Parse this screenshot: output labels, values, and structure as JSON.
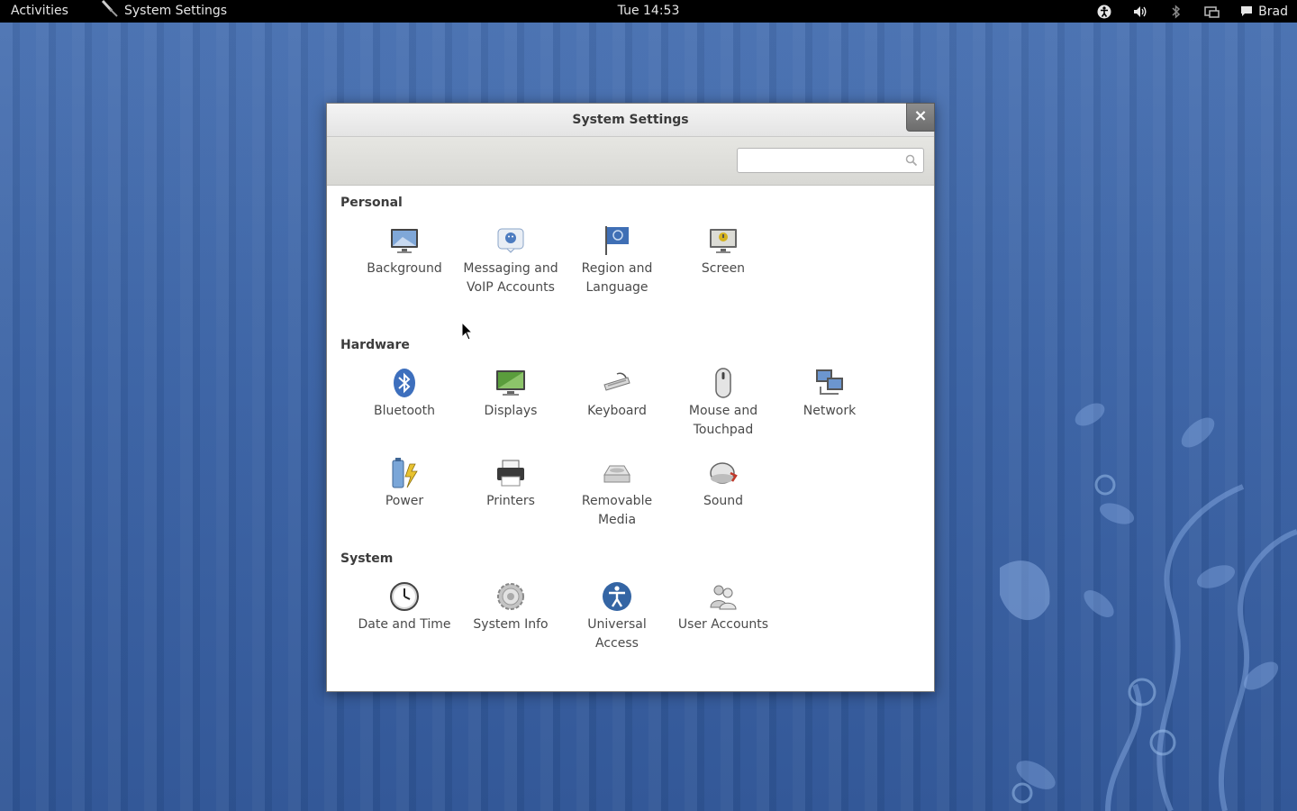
{
  "topbar": {
    "activities": "Activities",
    "app_name": "System Settings",
    "clock": "Tue 14:53",
    "user": "Brad"
  },
  "window": {
    "title": "System Settings",
    "close_glyph": "×",
    "search": {
      "value": "",
      "placeholder": ""
    }
  },
  "sections": {
    "personal": "Personal",
    "hardware": "Hardware",
    "system": "System"
  },
  "items": {
    "background": "Background",
    "messaging": "Messaging and VoIP Accounts",
    "region": "Region and Language",
    "screen": "Screen",
    "bluetooth": "Bluetooth",
    "displays": "Displays",
    "keyboard": "Keyboard",
    "mouse": "Mouse and Touchpad",
    "network": "Network",
    "power": "Power",
    "printers": "Printers",
    "removable": "Removable Media",
    "sound": "Sound",
    "datetime": "Date and Time",
    "sysinfo": "System Info",
    "universal": "Universal Access",
    "users": "User Accounts"
  },
  "colors": {
    "desktop": "#3b63a5",
    "topbar": "#000000",
    "accent": "#3465a4"
  }
}
